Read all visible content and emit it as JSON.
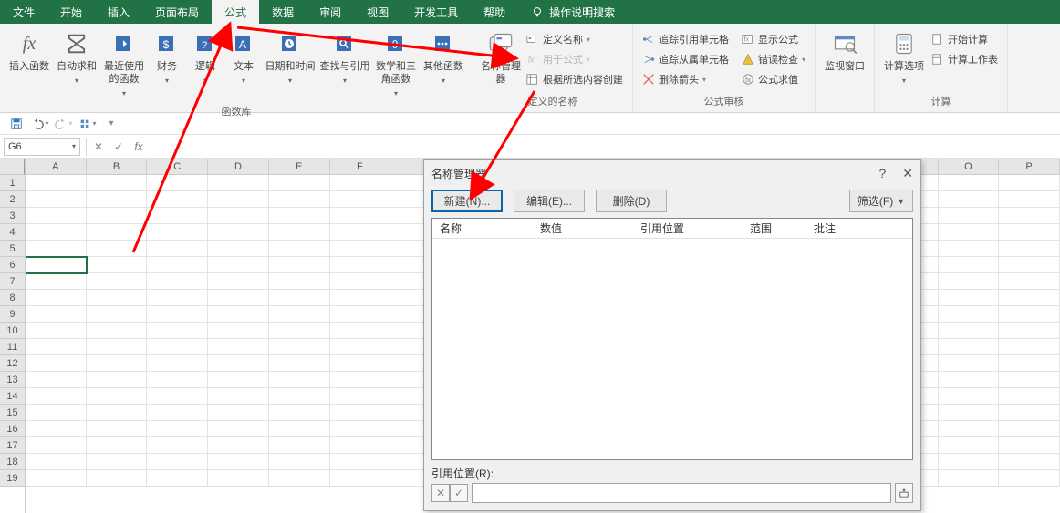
{
  "tabs": {
    "file": "文件",
    "home": "开始",
    "insert": "插入",
    "layout": "页面布局",
    "formulas": "公式",
    "data": "数据",
    "review": "审阅",
    "view": "视图",
    "devtools": "开发工具",
    "help": "帮助",
    "tellme": "操作说明搜索"
  },
  "ribbon": {
    "insert_fn": "插入函数",
    "fx": "fx",
    "autosum": "自动求和",
    "recent": "最近使用的函数",
    "financial": "财务",
    "logical": "逻辑",
    "text": "文本",
    "datetime": "日期和时间",
    "lookup": "查找与引用",
    "math": "数学和三角函数",
    "more": "其他函数",
    "group_lib": "函数库",
    "name_mgr": "名称管理器",
    "define_name": "定义名称",
    "use_formula": "用于公式",
    "create_sel": "根据所选内容创建",
    "group_names": "定义的名称",
    "trace_prec": "追踪引用单元格",
    "trace_dep": "追踪从属单元格",
    "remove_arrow": "删除箭头",
    "show_formulas": "显示公式",
    "error_check": "错误检查",
    "eval": "公式求值",
    "group_audit": "公式审核",
    "watch": "监视窗口",
    "calc_opts": "计算选项",
    "calc_now": "开始计算",
    "calc_sheet": "计算工作表",
    "group_calc": "计算"
  },
  "fxbar": {
    "name": "G6",
    "formula": ""
  },
  "sheet": {
    "cols": [
      "A",
      "B",
      "C",
      "D",
      "E",
      "F",
      "",
      "",
      "",
      "",
      "",
      "",
      "",
      "",
      "",
      "O",
      "P"
    ],
    "rows": [
      "1",
      "2",
      "3",
      "4",
      "5",
      "6",
      "7",
      "8",
      "9",
      "10",
      "11",
      "12",
      "13",
      "14",
      "15",
      "16",
      "17",
      "18",
      "19"
    ],
    "active": "G6"
  },
  "dialog": {
    "title": "名称管理器",
    "new": "新建(N)...",
    "edit": "编辑(E)...",
    "delete": "删除(D)",
    "filter": "筛选(F)",
    "cols": {
      "name": "名称",
      "value": "数值",
      "refers": "引用位置",
      "scope": "范围",
      "comment": "批注"
    },
    "refers_label": "引用位置(R):",
    "ref_value": ""
  }
}
